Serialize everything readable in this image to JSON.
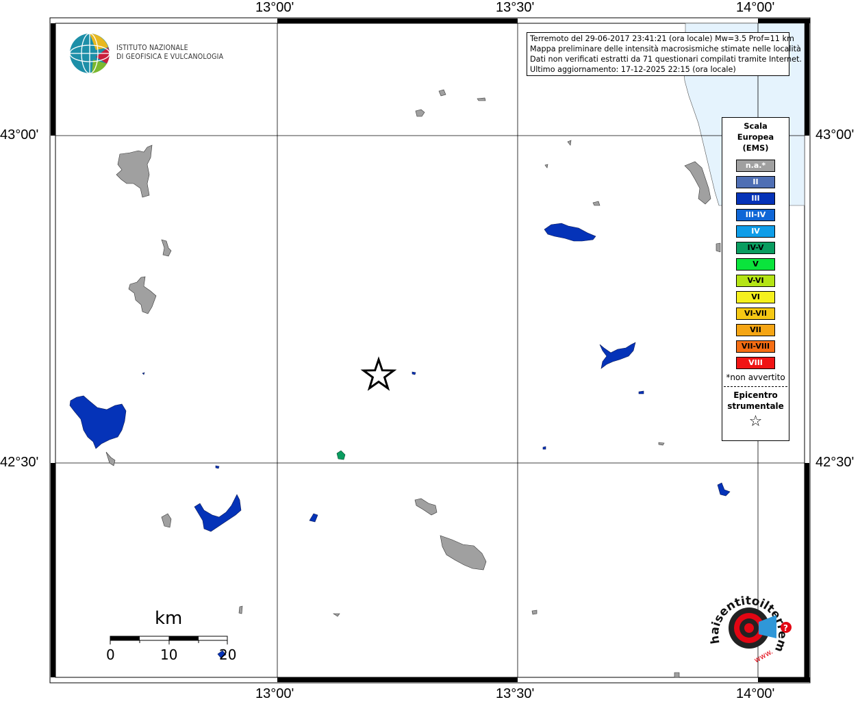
{
  "map": {
    "top_labels": [
      "13°00'",
      "13°30'",
      "14°00'"
    ],
    "bottom_labels": [
      "13°00'",
      "13°30'",
      "14°00'"
    ],
    "left_labels": [
      "43°00'",
      "42°30'"
    ],
    "right_labels": [
      "43°00'",
      "42°30'"
    ]
  },
  "info": {
    "line1": "Terremoto del 29-06-2017 23:41:21 (ora locale) Mw=3.5 Prof=11 km",
    "line2": "Mappa preliminare delle intensità macrosismiche stimate nelle località",
    "line3": "Dati non verificati estratti da 71 questionari compilati tramite Internet.",
    "line4": "Ultimo aggiornamento: 17-12-2025 22:15 (ora locale)"
  },
  "logo": {
    "line1": "ISTITUTO NAZIONALE",
    "line2": "DI GEOFISICA E VULCANOLOGIA"
  },
  "legend": {
    "title1": "Scala",
    "title2": "Europea",
    "title3": "(EMS)",
    "classes": [
      {
        "label": "n.a.*",
        "color": "#a0a0a0"
      },
      {
        "label": "II",
        "color": "#4f6fb4"
      },
      {
        "label": "III",
        "color": "#0533b8"
      },
      {
        "label": "III-IV",
        "color": "#0f66d6"
      },
      {
        "label": "IV",
        "color": "#0f9de8"
      },
      {
        "label": "IV-V",
        "color": "#0a9d60"
      },
      {
        "label": "V",
        "color": "#0ae43c"
      },
      {
        "label": "V-VI",
        "color": "#b4e414"
      },
      {
        "label": "VI",
        "color": "#f5f01e"
      },
      {
        "label": "VI-VII",
        "color": "#f5c814"
      },
      {
        "label": "VII",
        "color": "#f5a514"
      },
      {
        "label": "VII-VIII",
        "color": "#f56e14"
      },
      {
        "label": "VIII",
        "color": "#f01414"
      }
    ],
    "note": "*non avvertito",
    "epicentre1": "Epicentro",
    "epicentre2": "strumentale"
  },
  "scalebar": {
    "unit": "km",
    "labels": [
      "0",
      "10",
      "20"
    ]
  },
  "colors": {
    "sea": "#e5f3fd",
    "na": "#a0a0a0",
    "iii": "#0533b8",
    "ivv": "#0a9d60"
  },
  "brand": {
    "text": "haisentitoilterremoto.it",
    "url": "www.",
    "color": "#e30613"
  }
}
